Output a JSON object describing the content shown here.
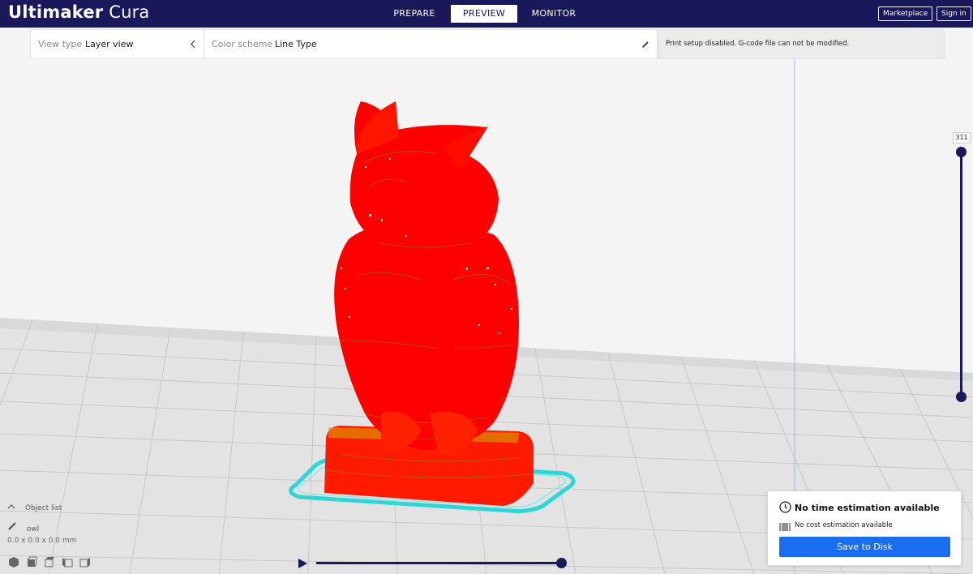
{
  "app": {
    "title_bold": "Ultimaker",
    "title_light": " Cura"
  },
  "stages": [
    {
      "label": "PREPARE"
    },
    {
      "label": "PREVIEW"
    },
    {
      "label": "MONITOR"
    }
  ],
  "header": {
    "marketplace_label": "Marketplace",
    "signin_label": "Sign in"
  },
  "view_bar": {
    "view_type_label": "View type",
    "view_type_value": "Layer view",
    "color_scheme_label": "Color scheme",
    "color_scheme_value": "Line Type"
  },
  "print_setup_message": "Print setup disabled. G-code file can not be modified.",
  "layer_slider": {
    "value": "311"
  },
  "object_list": {
    "label": "Object list",
    "item_name": "owl",
    "dimensions": "0.0 x 0.0 x 0.0 mm"
  },
  "print_info": {
    "time": "No time estimation available",
    "cost": "No cost estimation available",
    "save_label": "Save to Disk"
  },
  "colors": {
    "header_bg": "#19185a",
    "accent_blue": "#196ef0",
    "model_red": "#ff0000",
    "skirt_cyan": "#2fd6d6"
  }
}
